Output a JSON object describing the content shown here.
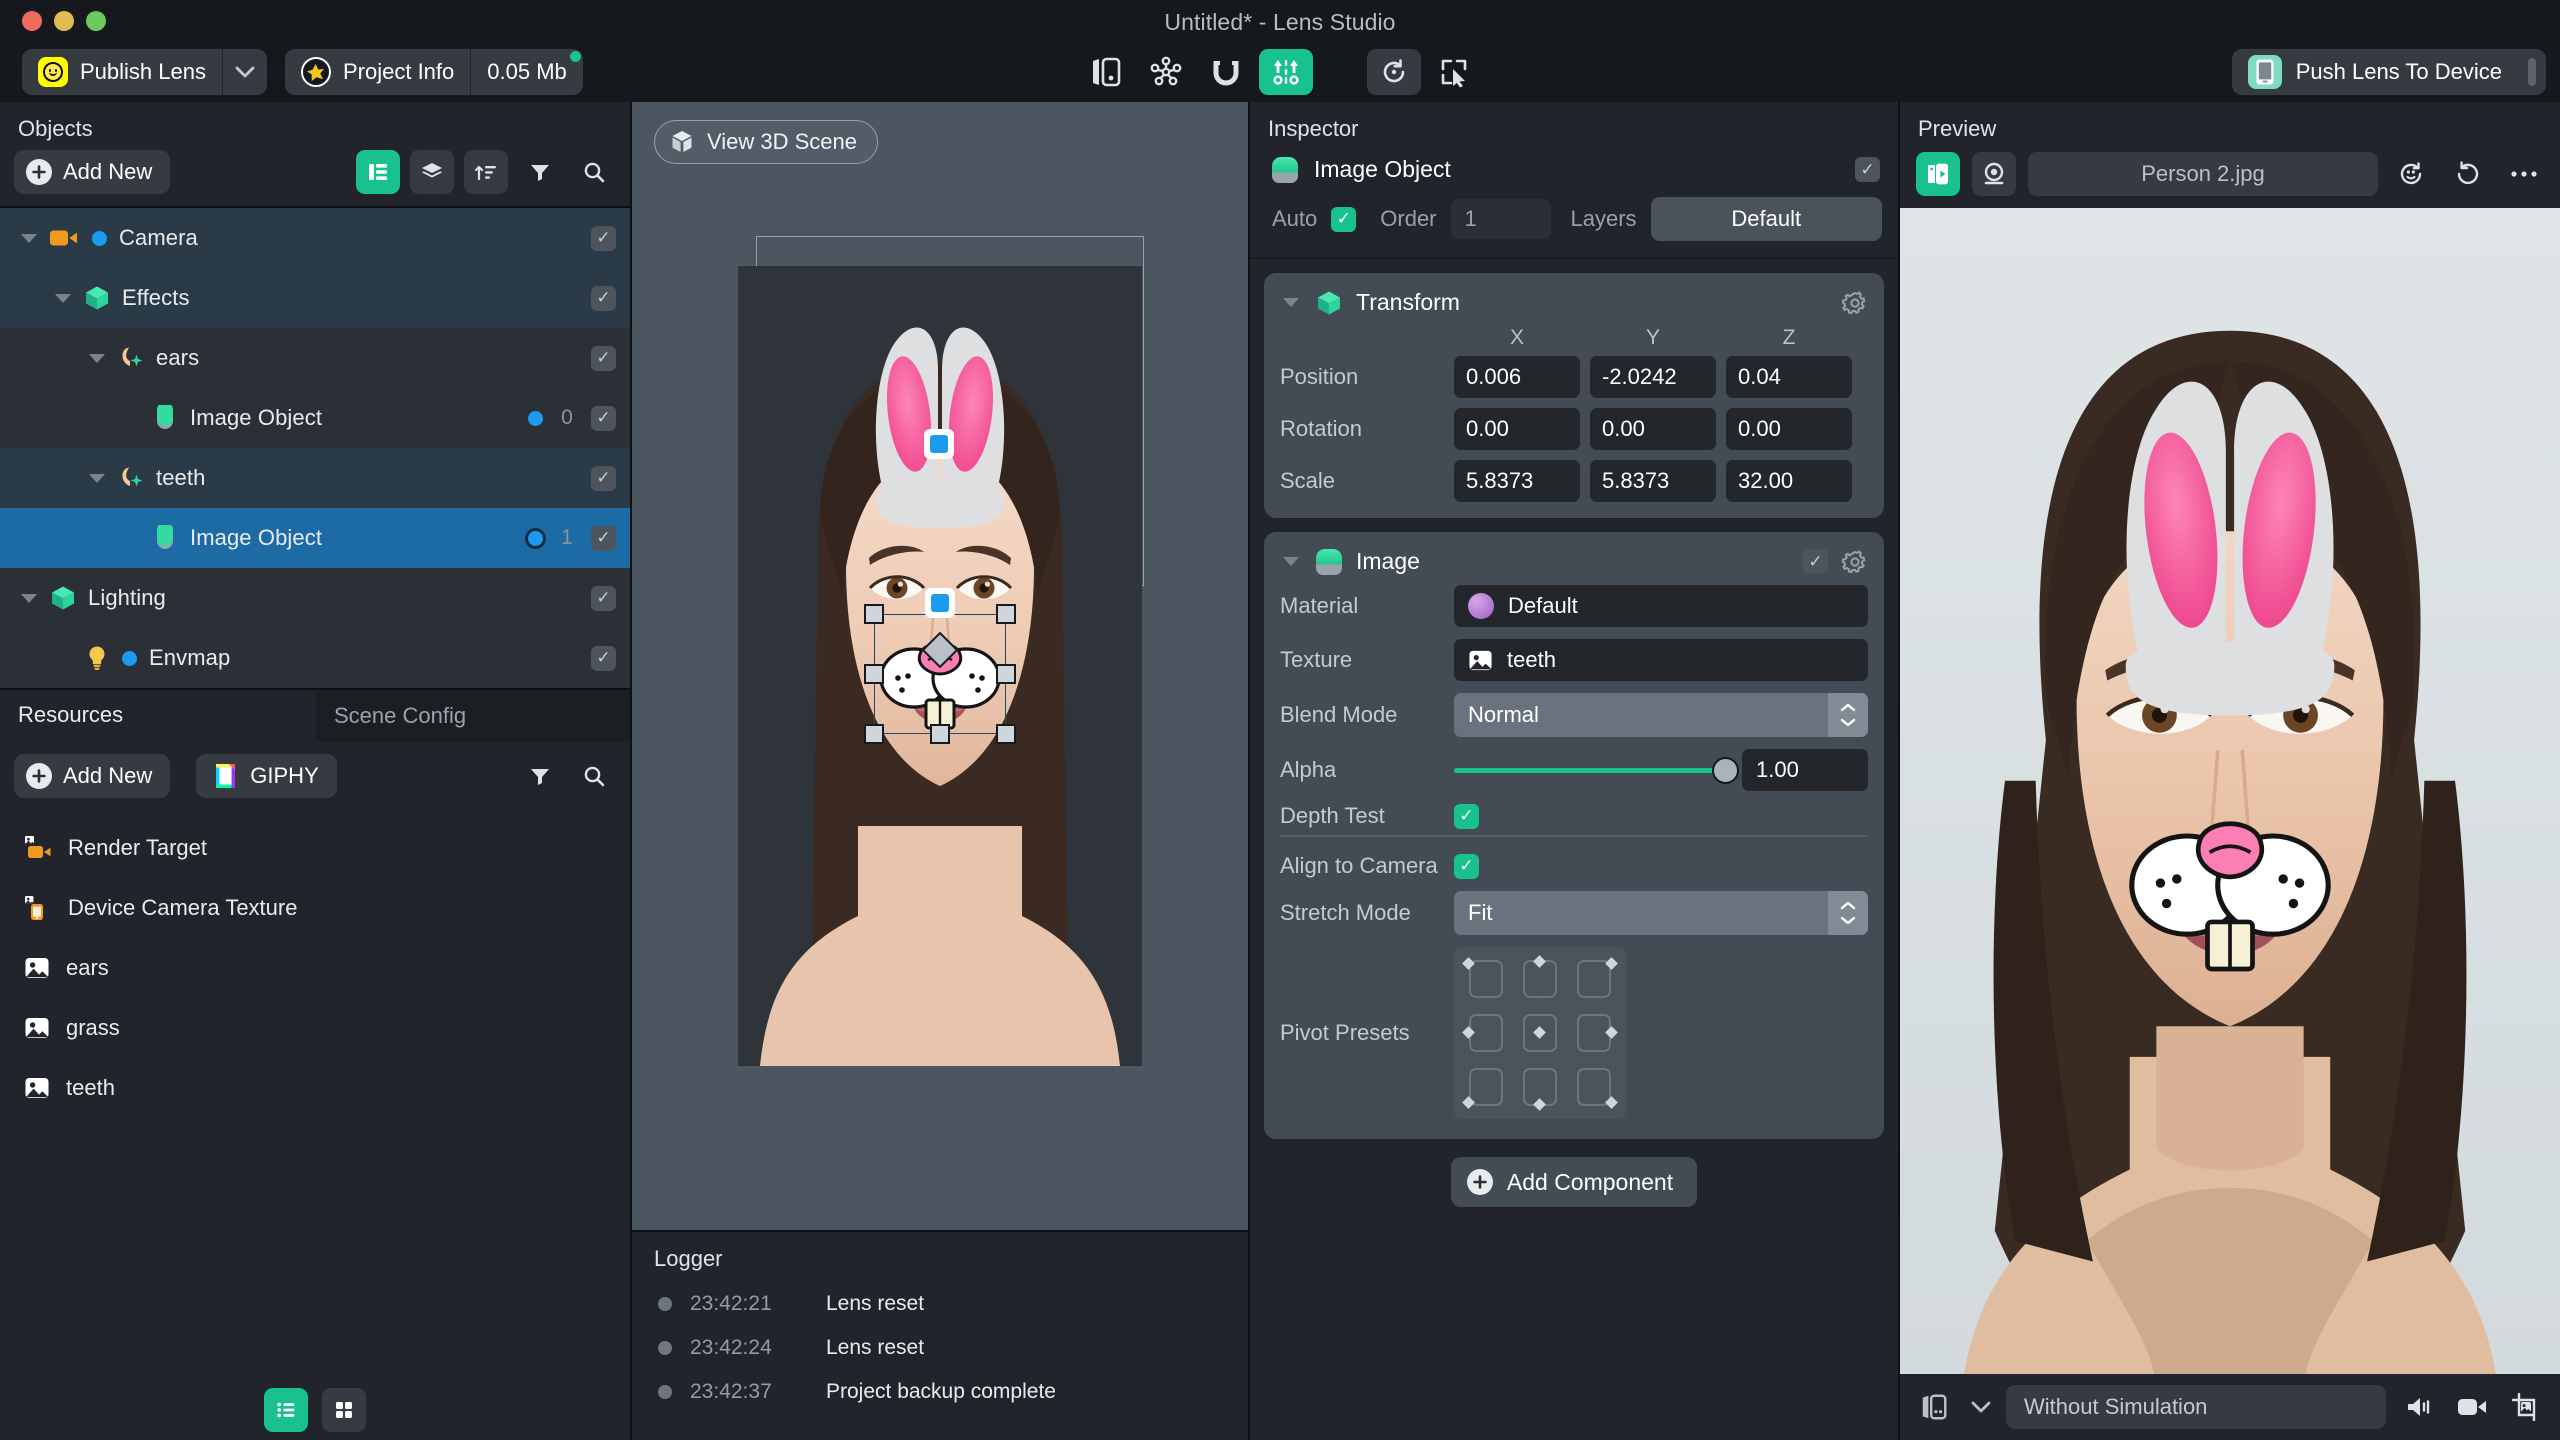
{
  "window": {
    "title": "Untitled* - Lens Studio"
  },
  "toolbar": {
    "publish_label": "Publish Lens",
    "publish_caret_icon": "chevron-down-icon",
    "project_info_label": "Project Info",
    "size_label": "0.05 Mb",
    "center_icons": [
      "device-preview-icon",
      "asset-library-icon",
      "magnet-snap-icon",
      "align-distribute-icon",
      "reset-icon",
      "cursor-select-icon"
    ],
    "push_label": "Push Lens To Device"
  },
  "objects_panel": {
    "title": "Objects",
    "add_new_label": "Add New",
    "view_icons": [
      "list-view-icon",
      "layers-icon",
      "sort-icon",
      "filter-icon",
      "search-icon"
    ],
    "tree": [
      {
        "label": "Camera",
        "depth": 0,
        "icon": "camera-icon",
        "dot": true,
        "order": "",
        "checked": true,
        "state": "hl"
      },
      {
        "label": "Effects",
        "depth": 1,
        "icon": "object-cube-icon",
        "dot": false,
        "order": "",
        "checked": true,
        "state": "hl"
      },
      {
        "label": "ears",
        "depth": 2,
        "icon": "face-effect-icon",
        "dot": false,
        "order": "",
        "checked": true,
        "state": "dark"
      },
      {
        "label": "Image Object",
        "depth": 3,
        "icon": "image-object-icon",
        "dot": true,
        "order": "0",
        "checked": true,
        "state": "dark"
      },
      {
        "label": "teeth",
        "depth": 2,
        "icon": "face-effect-icon",
        "dot": false,
        "order": "",
        "checked": true,
        "state": "hl"
      },
      {
        "label": "Image Object",
        "depth": 3,
        "icon": "image-object-icon",
        "dot": true,
        "order": "1",
        "checked": true,
        "state": "sel"
      },
      {
        "label": "Lighting",
        "depth": 0,
        "icon": "object-cube-icon",
        "dot": false,
        "order": "",
        "checked": true,
        "state": "dark"
      },
      {
        "label": "Envmap",
        "depth": 1,
        "icon": "light-bulb-icon",
        "dot": true,
        "order": "",
        "checked": true,
        "state": "dark"
      }
    ]
  },
  "resources_panel": {
    "tab_resources": "Resources",
    "tab_scene_config": "Scene Config",
    "add_new_label": "Add New",
    "giphy_label": "GIPHY",
    "items": [
      {
        "label": "Render Target",
        "icon": "render-target-icon"
      },
      {
        "label": "Device Camera Texture",
        "icon": "device-camera-texture-icon"
      },
      {
        "label": "ears",
        "icon": "image-texture-icon"
      },
      {
        "label": "grass",
        "icon": "image-texture-icon"
      },
      {
        "label": "teeth",
        "icon": "image-texture-icon"
      }
    ],
    "footer_icons": [
      "list-view-icon",
      "grid-view-icon"
    ]
  },
  "viewport": {
    "view_3d_label": "View 3D Scene"
  },
  "logger": {
    "title": "Logger",
    "entries": [
      {
        "time": "23:42:21",
        "message": "Lens reset"
      },
      {
        "time": "23:42:24",
        "message": "Lens reset"
      },
      {
        "time": "23:42:37",
        "message": "Project backup complete"
      }
    ]
  },
  "inspector": {
    "title": "Inspector",
    "object_name": "Image Object",
    "object_enabled": true,
    "auto_label": "Auto",
    "auto_checked": true,
    "order_label": "Order",
    "order_value": "1",
    "layers_label": "Layers",
    "layers_value": "Default",
    "transform": {
      "title": "Transform",
      "axes": [
        "X",
        "Y",
        "Z"
      ],
      "rows": [
        {
          "label": "Position",
          "values": [
            "0.006",
            "-2.0242",
            "0.04"
          ]
        },
        {
          "label": "Rotation",
          "values": [
            "0.00",
            "0.00",
            "0.00"
          ]
        },
        {
          "label": "Scale",
          "values": [
            "5.8373",
            "5.8373",
            "32.00"
          ]
        }
      ]
    },
    "image": {
      "title": "Image",
      "enabled": true,
      "material_label": "Material",
      "material_value": "Default",
      "texture_label": "Texture",
      "texture_value": "teeth",
      "blend_mode_label": "Blend Mode",
      "blend_mode_value": "Normal",
      "alpha_label": "Alpha",
      "alpha_value": "1.00",
      "alpha_fraction": 1.0,
      "depth_test_label": "Depth Test",
      "depth_test_checked": true,
      "align_to_camera_label": "Align to Camera",
      "align_to_camera_checked": true,
      "stretch_mode_label": "Stretch Mode",
      "stretch_mode_value": "Fit",
      "pivot_presets_label": "Pivot Presets"
    },
    "add_component_label": "Add Component"
  },
  "preview": {
    "title": "Preview",
    "source_name": "Person 2.jpg",
    "toolbar_icons": [
      "media-preview-icon",
      "webcam-icon",
      "snapcode-refresh-icon",
      "reset-rotate-icon",
      "more-options-icon"
    ],
    "footer_simulation": "Without Simulation",
    "footer_icons": [
      "device-frame-icon",
      "chevron-down-icon",
      "speaker-icon",
      "record-video-icon",
      "screenshot-icon"
    ]
  },
  "colors": {
    "accent_green": "#19c18d",
    "selection_blue": "#1d6ba5",
    "panel_bg": "#21252b",
    "tree_bg": "#2b3036",
    "viewport_bg": "#4c5661",
    "card_bg": "#434b54",
    "field_bg": "#23272c",
    "snap_yellow": "#FFFC00",
    "bunny_pink": "#f9639f",
    "bunny_grey": "#dddfe1"
  }
}
